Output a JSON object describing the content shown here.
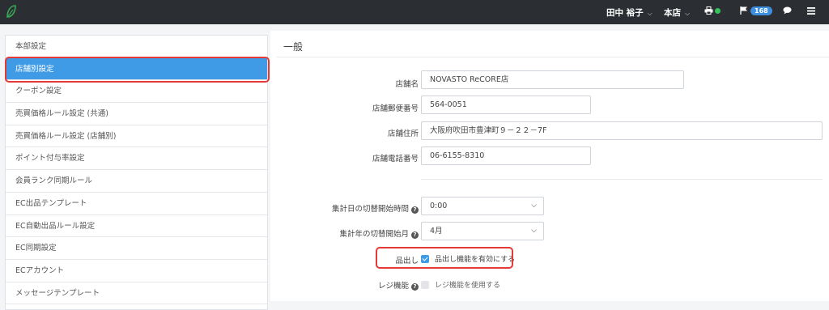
{
  "topbar": {
    "user_name": "田中 裕子",
    "store": "本店",
    "notification_count": "168",
    "status_color": "#36c25b"
  },
  "sidebar": {
    "items": [
      {
        "label": "本部設定"
      },
      {
        "label": "店舗別設定",
        "active": true
      },
      {
        "label": "クーポン設定"
      },
      {
        "label": "売買価格ルール設定 (共通)"
      },
      {
        "label": "売買価格ルール設定 (店舗別)"
      },
      {
        "label": "ポイント付与率設定"
      },
      {
        "label": "会員ランク同期ルール"
      },
      {
        "label": "EC出品テンプレート"
      },
      {
        "label": "EC自動出品ルール設定"
      },
      {
        "label": "EC同期設定"
      },
      {
        "label": "ECアカウント"
      },
      {
        "label": "メッセージテンプレート"
      }
    ]
  },
  "main": {
    "section_title": "一般",
    "store_name_label": "店舗名",
    "store_name_value": "NOVASTO ReCORE店",
    "postal_label": "店舗郵便番号",
    "postal_value": "564-0051",
    "address_label": "店舗住所",
    "address_value": "大阪府吹田市豊津町９－２２－7F",
    "phone_label": "店舗電話番号",
    "phone_value": "06-6155-8310",
    "close_time_label": "集計日の切替開始時間",
    "close_time_value": "0:00",
    "fiscal_month_label": "集計年の切替開始月",
    "fiscal_month_value": "4月",
    "picking_label": "品出し",
    "picking_checkbox_label": "品出し機能を有効にする",
    "picking_checked": true,
    "register_label": "レジ機能",
    "register_checkbox_label": "レジ機能を使用する",
    "register_checked": false
  },
  "colors": {
    "topbar": "#2b2f33",
    "accent": "#3f9be6",
    "highlight": "#e53935",
    "logo": "#3aa655"
  }
}
